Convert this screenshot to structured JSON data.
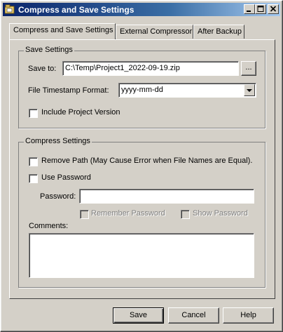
{
  "window": {
    "title": "Compress and Save Settings",
    "icon": "app-icon"
  },
  "tabs": [
    {
      "label": "Compress and Save Settings",
      "accel": "o",
      "active": true
    },
    {
      "label": "External Compressor",
      "active": false
    },
    {
      "label": "After Backup",
      "active": false
    }
  ],
  "save_settings": {
    "group_label": "Save Settings",
    "save_to_label": "Save to:",
    "save_to_value": "C:\\Temp\\Project1_2022-09-19.zip",
    "browse_label": "...",
    "timestamp_label": "File Timestamp Format:",
    "timestamp_value": "yyyy-mm-dd",
    "include_version_label": "Include Project Version",
    "include_version_checked": false
  },
  "compress_settings": {
    "group_label": "Compress Settings",
    "remove_path_label": "Remove Path (May Cause Error when File Names are Equal).",
    "remove_path_checked": false,
    "use_password_label": "Use Password",
    "use_password_checked": false,
    "password_label": "Password:",
    "password_value": "",
    "remember_password_label": "Remember Password",
    "show_password_label": "Show Password",
    "comments_label": "Comments:",
    "comments_value": ""
  },
  "buttons": {
    "save": "Save",
    "cancel": "Cancel",
    "help": "Help"
  },
  "titlebar_buttons": {
    "minimize": "_",
    "maximize": "□",
    "close": "×"
  }
}
